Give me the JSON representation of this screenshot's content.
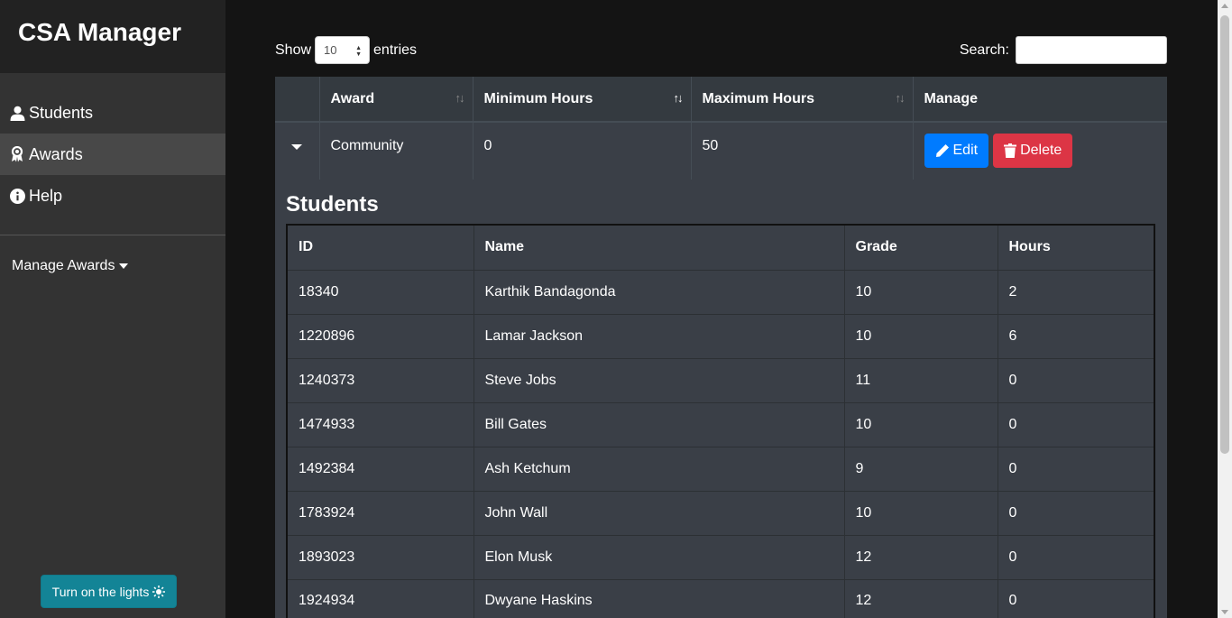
{
  "sidebar": {
    "brand": "CSA Manager",
    "items": [
      {
        "label": "Students",
        "icon": "user-icon"
      },
      {
        "label": "Awards",
        "icon": "award-icon",
        "active": true
      },
      {
        "label": "Help",
        "icon": "info-icon"
      }
    ],
    "manage_awards": "Manage Awards",
    "lights_button": "Turn on the lights"
  },
  "controls": {
    "show_label": "Show",
    "entries_value": "10",
    "entries_label": "entries",
    "search_label": "Search:",
    "search_value": ""
  },
  "awards_table": {
    "headers": [
      "Award",
      "Minimum Hours",
      "Maximum Hours",
      "Manage"
    ],
    "row": {
      "award": "Community",
      "min_hours": "0",
      "max_hours": "50",
      "edit_label": "Edit",
      "delete_label": "Delete"
    }
  },
  "students": {
    "title": "Students",
    "headers": [
      "ID",
      "Name",
      "Grade",
      "Hours"
    ],
    "rows": [
      [
        "18340",
        "Karthik Bandagonda",
        "10",
        "2"
      ],
      [
        "1220896",
        "Lamar Jackson",
        "10",
        "6"
      ],
      [
        "1240373",
        "Steve Jobs",
        "11",
        "0"
      ],
      [
        "1474933",
        "Bill Gates",
        "10",
        "0"
      ],
      [
        "1492384",
        "Ash Ketchum",
        "9",
        "0"
      ],
      [
        "1783924",
        "John Wall",
        "10",
        "0"
      ],
      [
        "1893023",
        "Elon Musk",
        "12",
        "0"
      ],
      [
        "1924934",
        "Dwyane Haskins",
        "12",
        "0"
      ]
    ]
  },
  "colors": {
    "sidebar_bg": "#333333",
    "brand_bg": "#222222",
    "active_item": "#484848",
    "edit": "#007bff",
    "delete": "#dc3545",
    "lights": "#138496"
  }
}
